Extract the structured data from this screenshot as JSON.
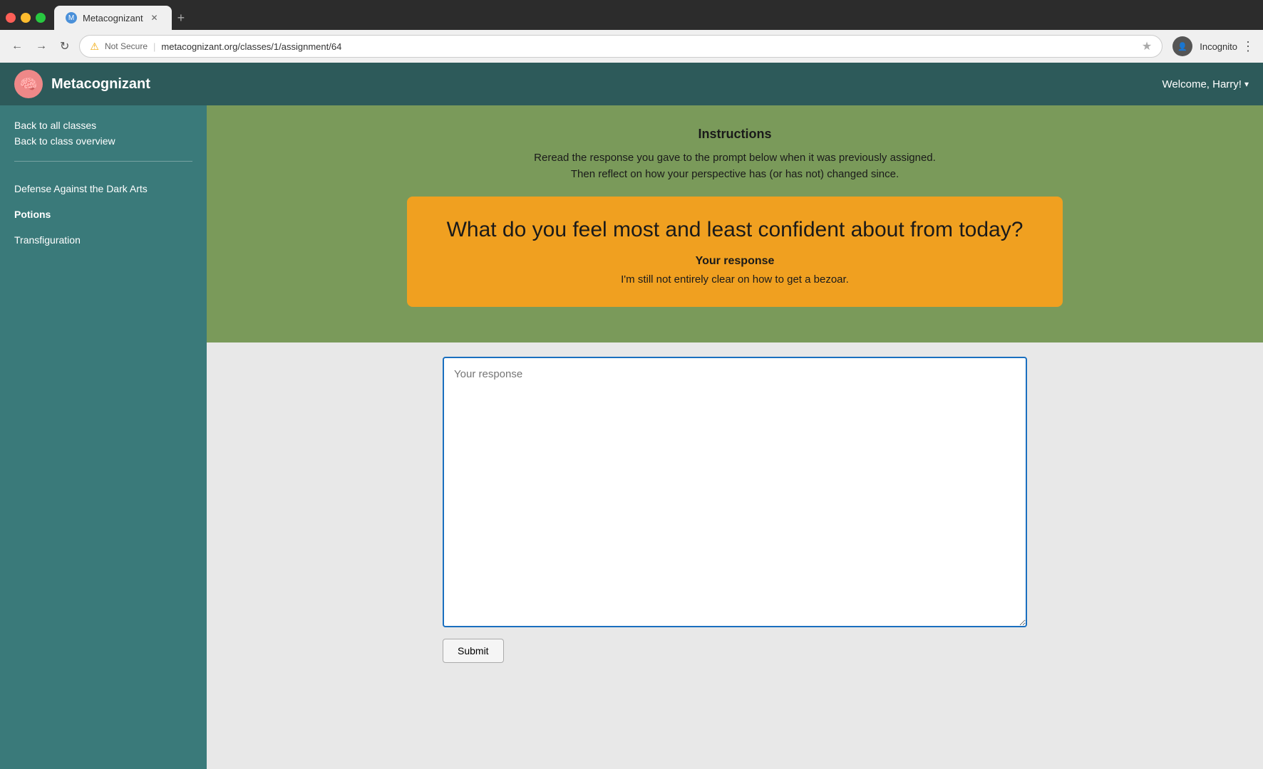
{
  "browser": {
    "tab_title": "Metacognizant",
    "url": "metacognizant.org/classes/1/assignment/64",
    "url_full": "metacognizant.org/classes/1/assignment/64",
    "security_label": "Not Secure",
    "incognito_label": "Incognito",
    "new_tab_symbol": "+"
  },
  "topnav": {
    "brand_name": "Metacognizant",
    "welcome_text": "Welcome, Harry!",
    "dropdown_symbol": "▾"
  },
  "sidebar": {
    "back_to_all_classes": "Back to all classes",
    "back_to_class_overview": "Back to class overview",
    "classes": [
      {
        "label": "Defense Against the Dark Arts",
        "active": false
      },
      {
        "label": "Potions",
        "active": true
      },
      {
        "label": "Transfiguration",
        "active": false
      }
    ]
  },
  "instructions": {
    "title": "Instructions",
    "line1": "Reread the response you gave to the prompt below when it was previously assigned.",
    "line2": "Then reflect on how your perspective has (or has not) changed since."
  },
  "prompt": {
    "question": "What do you feel most and least confident about from today?",
    "response_label": "Your response",
    "response_text": "I'm still not entirely clear on how to get a bezoar."
  },
  "response_area": {
    "placeholder": "Your response",
    "submit_label": "Submit"
  }
}
